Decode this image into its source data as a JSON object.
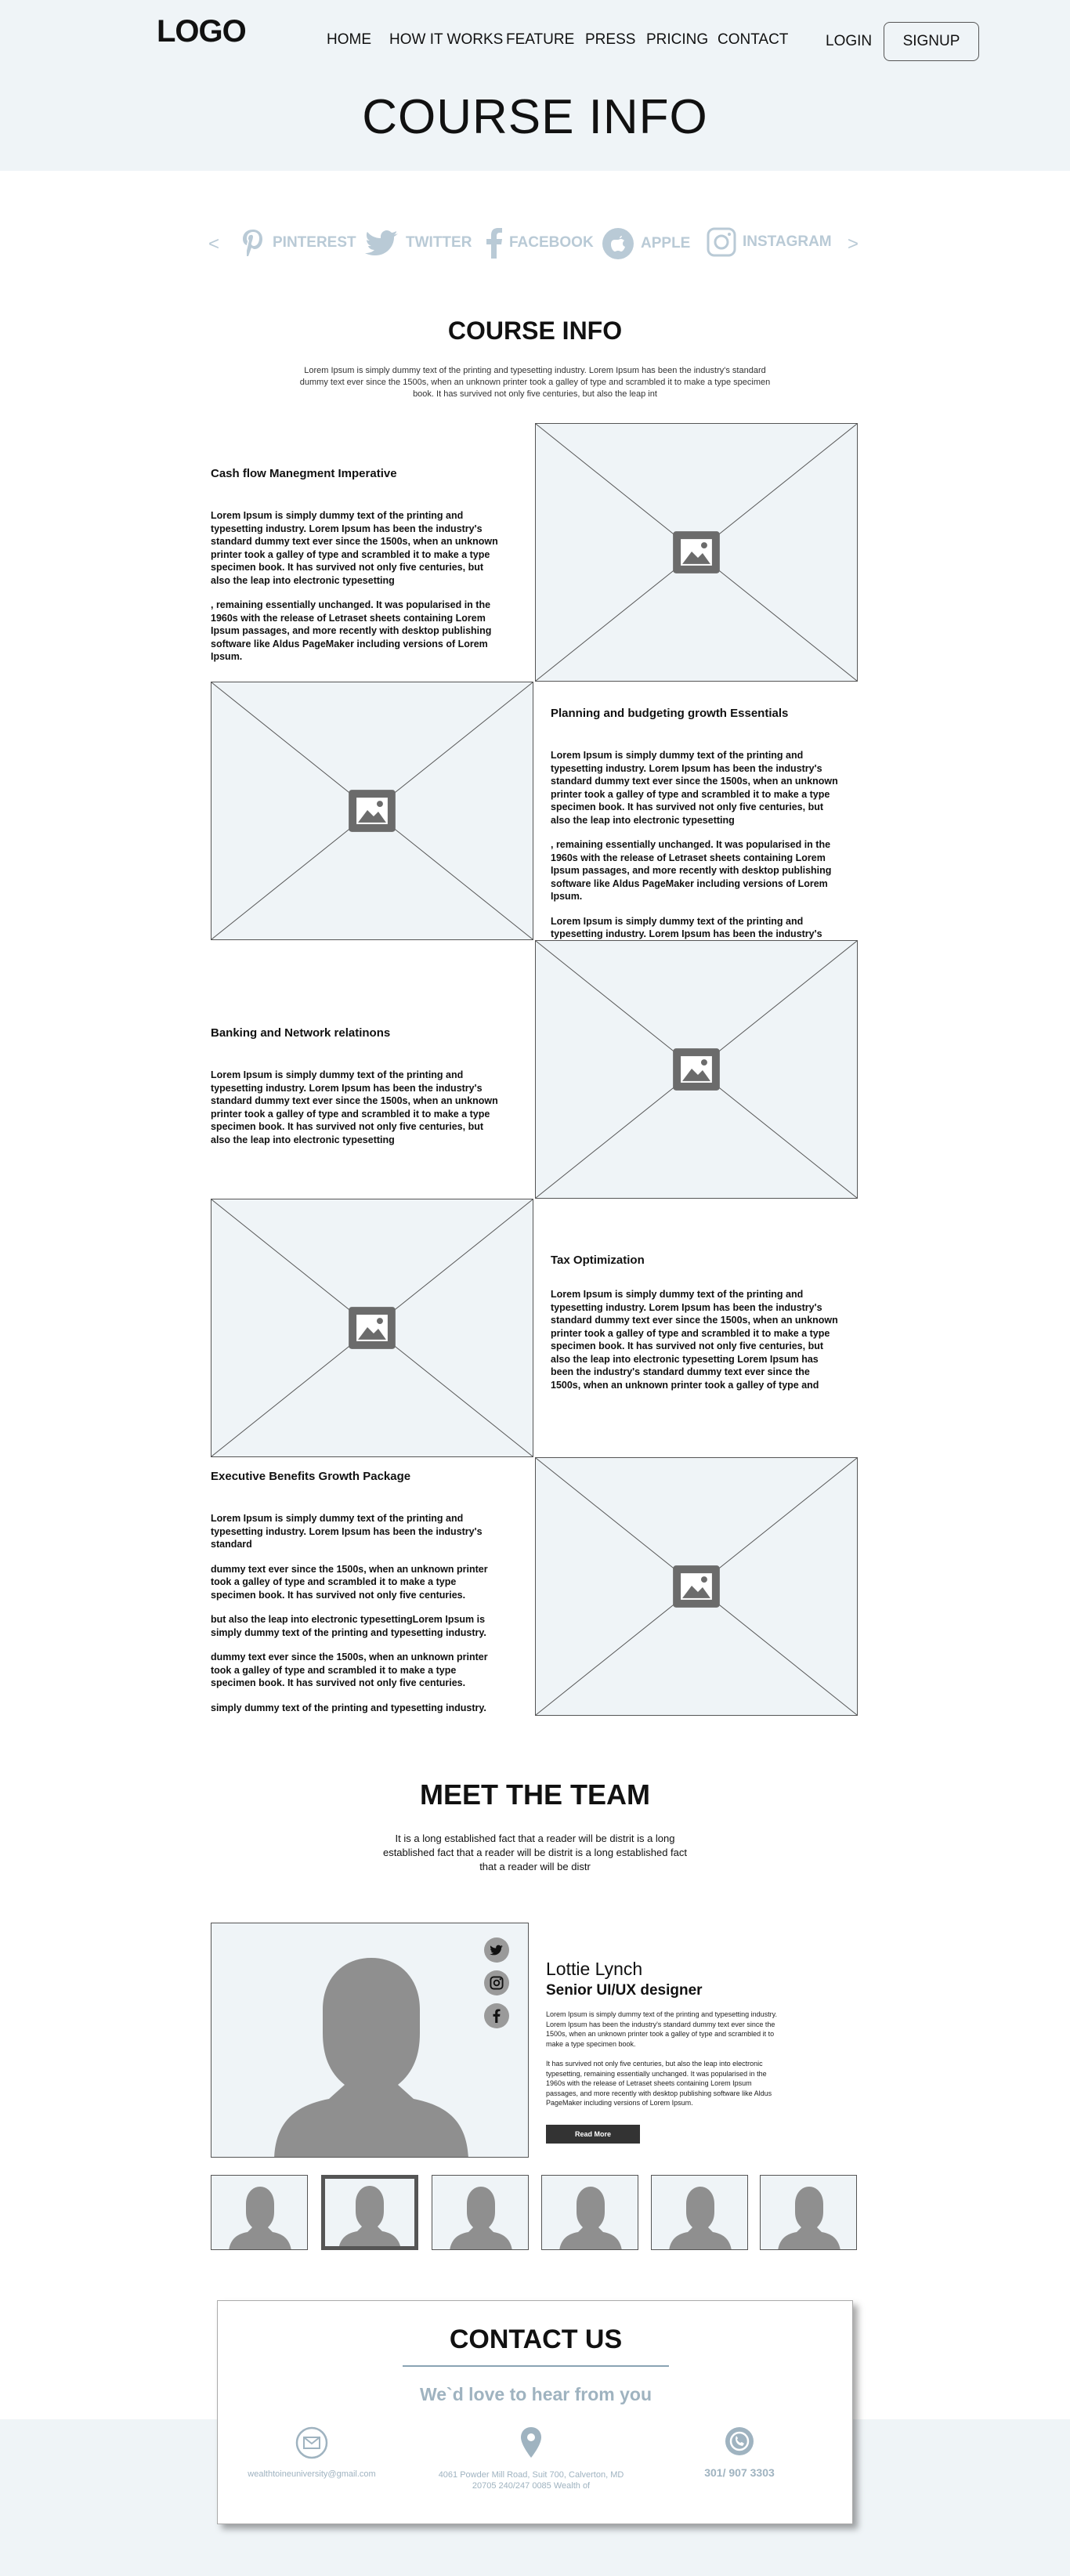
{
  "header": {
    "logo": "LOGO",
    "nav": [
      "HOME",
      "HOW IT WORKS",
      "FEATURE",
      "PRESS",
      "PRICING",
      "CONTACT"
    ],
    "login": "LOGIN",
    "signup": "SIGNUP",
    "page_title": "COURSE INFO"
  },
  "logos": {
    "items": [
      {
        "label": "PINTEREST",
        "icon": "pinterest-icon"
      },
      {
        "label": "TWITTER",
        "icon": "twitter-icon"
      },
      {
        "label": "FACEBOOK",
        "icon": "facebook-icon"
      },
      {
        "label": "APPLE",
        "icon": "apple-icon"
      },
      {
        "label": "INSTAGRAM",
        "icon": "instagram-icon"
      }
    ],
    "prev": "<",
    "next": ">"
  },
  "course": {
    "title": "COURSE INFO",
    "intro": "Lorem Ipsum is simply dummy text of the printing and typesetting industry. Lorem Ipsum has been the industry's standard dummy text ever since the 1500s, when an unknown printer took a galley of type and scrambled it to make a type specimen book. It has survived not only five centuries, but also the leap int",
    "blocks": [
      {
        "heading": "Cash flow Manegment Imperative",
        "paragraphs": [
          "Lorem Ipsum is simply dummy text of the printing and typesetting industry. Lorem Ipsum has been the industry's standard dummy text ever since the 1500s, when an unknown printer took a galley of type and scrambled it to make a type specimen book. It has survived not only five centuries, but also the leap into electronic typesetting",
          ", remaining essentially unchanged. It was popularised in the 1960s with the release of Letraset sheets containing Lorem Ipsum passages, and more recently with desktop publishing software like Aldus PageMaker including versions of Lorem Ipsum."
        ]
      },
      {
        "heading": "Planning and budgeting growth Essentials",
        "paragraphs": [
          "Lorem Ipsum is simply dummy text of the printing and typesetting industry. Lorem Ipsum has been the industry's standard dummy text ever since the 1500s, when an unknown printer took a galley of type and scrambled it to make a type specimen book. It has survived not only five centuries, but also the leap into electronic typesetting",
          ", remaining essentially unchanged. It was popularised in the 1960s with the release of Letraset sheets containing Lorem Ipsum passages, and more recently with desktop publishing software like Aldus PageMaker including versions of Lorem Ipsum.",
          "Lorem Ipsum is simply dummy text of the printing and typesetting industry. Lorem Ipsum has been the industry's standard dummy text ever since"
        ]
      },
      {
        "heading": "Banking and Network relatinons",
        "paragraphs": [
          "Lorem Ipsum is simply dummy text of the printing and typesetting industry. Lorem Ipsum has been the industry's standard dummy text ever since the 1500s, when an unknown printer took a galley of type and scrambled it to make a type specimen book. It has survived not only five centuries, but also the leap into electronic typesetting"
        ]
      },
      {
        "heading": "Tax Optimization",
        "paragraphs": [
          "Lorem Ipsum is simply dummy text of the printing and typesetting industry. Lorem Ipsum has been the industry's standard dummy text ever since the 1500s, when an unknown printer took a galley of type and scrambled it to make a type specimen book. It has survived not only five centuries, but also the leap into electronic typesetting Lorem Ipsum has been the industry's standard dummy text ever since the 1500s, when an unknown printer took a galley of type and"
        ]
      },
      {
        "heading": "Executive Benefits Growth Package",
        "paragraphs": [
          "Lorem Ipsum is simply dummy text of the printing and typesetting industry. Lorem Ipsum has been the industry's standard",
          "dummy text ever since the 1500s, when an unknown printer took a galley of type and scrambled it to make a type specimen book. It has survived not only five centuries.",
          " but also the leap into electronic typesettingLorem Ipsum is simply dummy text of the printing and typesetting industry.",
          "dummy text ever since the 1500s, when an unknown printer took a galley of type and scrambled it to make a type specimen book. It has survived not only five centuries.",
          "simply dummy text of the printing and typesetting industry."
        ]
      }
    ]
  },
  "team": {
    "title": "MEET THE TEAM",
    "intro": "It is a long established fact that a reader will be distrit is a long established fact that a reader will be distrit is a long established fact that a reader will be distr",
    "member": {
      "name": "Lottie Lynch",
      "role": "Senior UI/UX designer",
      "bio1": "Lorem Ipsum is simply dummy text of the printing and typesetting industry. Lorem Ipsum has been the industry's standard dummy text ever since the 1500s, when an unknown printer took a galley of type and scrambled it to make a type specimen book.",
      "bio2": " It has survived not only five centuries, but also the leap into electronic typesetting, remaining essentially unchanged. It was popularised in the 1960s with the release of Letraset sheets containing Lorem Ipsum passages, and more recently with desktop publishing software like Aldus PageMaker including versions of Lorem Ipsum.",
      "read_more": "Read More",
      "socials": [
        "twitter-icon",
        "instagram-icon",
        "facebook-icon"
      ]
    }
  },
  "contact": {
    "title": "CONTACT US",
    "subtitle": "We`d love to hear from you",
    "email": "wealthtoineuniversity@gmail.com",
    "address": "4061 Powder Mill Road, Suit 700, Calverton, MD 20705 240/247 0085 Wealth of",
    "phone": "301/ 907 3303"
  }
}
